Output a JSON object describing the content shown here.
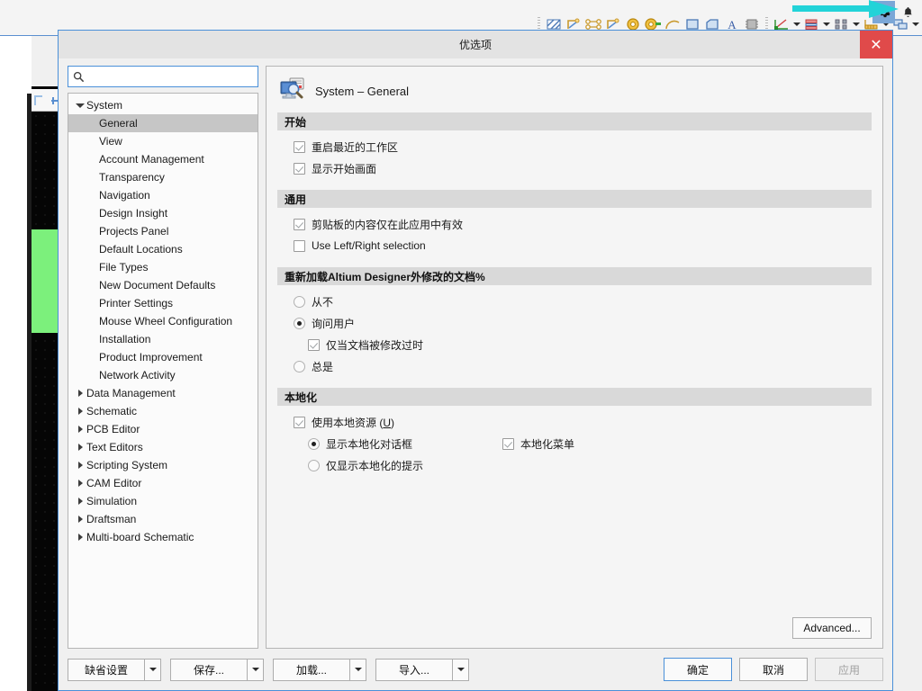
{
  "background": {
    "toolbar": {
      "icons": [
        "hatch-fill-icon",
        "polygon-pour-icon",
        "net-connect-icon",
        "polygon-cutout-icon",
        "via-icon",
        "pad-icon",
        "arc-icon",
        "fill-rect-icon",
        "board-shape-icon",
        "text-string-icon",
        "component-icon"
      ],
      "dropdown_groups": [
        "measure-tool-icon",
        "plane-layers-icon",
        "find-similar-icon",
        "dimension-icon",
        "layer-stack-icon"
      ],
      "gear_label": "gear-icon",
      "bell_label": "bell-icon"
    },
    "annotation_arrow_color": "#22d3d8"
  },
  "dialog": {
    "title": "优选项",
    "close_label": "✕",
    "search": {
      "value": "",
      "placeholder": ""
    },
    "tree": [
      {
        "label": "System",
        "level": 0,
        "twisty": "open",
        "selected": false
      },
      {
        "label": "General",
        "level": 1,
        "twisty": "none",
        "selected": true
      },
      {
        "label": "View",
        "level": 1,
        "twisty": "none",
        "selected": false
      },
      {
        "label": "Account Management",
        "level": 1,
        "twisty": "none",
        "selected": false
      },
      {
        "label": "Transparency",
        "level": 1,
        "twisty": "none",
        "selected": false
      },
      {
        "label": "Navigation",
        "level": 1,
        "twisty": "none",
        "selected": false
      },
      {
        "label": "Design Insight",
        "level": 1,
        "twisty": "none",
        "selected": false
      },
      {
        "label": "Projects Panel",
        "level": 1,
        "twisty": "none",
        "selected": false
      },
      {
        "label": "Default Locations",
        "level": 1,
        "twisty": "none",
        "selected": false
      },
      {
        "label": "File Types",
        "level": 1,
        "twisty": "none",
        "selected": false
      },
      {
        "label": "New Document Defaults",
        "level": 1,
        "twisty": "none",
        "selected": false
      },
      {
        "label": "Printer Settings",
        "level": 1,
        "twisty": "none",
        "selected": false
      },
      {
        "label": "Mouse Wheel Configuration",
        "level": 1,
        "twisty": "none",
        "selected": false
      },
      {
        "label": "Installation",
        "level": 1,
        "twisty": "none",
        "selected": false
      },
      {
        "label": "Product Improvement",
        "level": 1,
        "twisty": "none",
        "selected": false
      },
      {
        "label": "Network Activity",
        "level": 1,
        "twisty": "none",
        "selected": false
      },
      {
        "label": "Data Management",
        "level": 0,
        "twisty": "closed",
        "selected": false
      },
      {
        "label": "Schematic",
        "level": 0,
        "twisty": "closed",
        "selected": false
      },
      {
        "label": "PCB Editor",
        "level": 0,
        "twisty": "closed",
        "selected": false
      },
      {
        "label": "Text Editors",
        "level": 0,
        "twisty": "closed",
        "selected": false
      },
      {
        "label": "Scripting System",
        "level": 0,
        "twisty": "closed",
        "selected": false
      },
      {
        "label": "CAM Editor",
        "level": 0,
        "twisty": "closed",
        "selected": false
      },
      {
        "label": "Simulation",
        "level": 0,
        "twisty": "closed",
        "selected": false
      },
      {
        "label": "Draftsman",
        "level": 0,
        "twisty": "closed",
        "selected": false
      },
      {
        "label": "Multi-board Schematic",
        "level": 0,
        "twisty": "closed",
        "selected": false
      }
    ],
    "page": {
      "icon": "system-general-icon",
      "title": "System – General",
      "sections": [
        {
          "heading": "开始",
          "options": [
            {
              "type": "checkbox",
              "label": "重启最近的工作区",
              "checked": true,
              "indent": 1
            },
            {
              "type": "checkbox",
              "label": "显示开始画面",
              "checked": true,
              "indent": 1
            }
          ]
        },
        {
          "heading": "通用",
          "options": [
            {
              "type": "checkbox",
              "label": "剪贴板的内容仅在此应用中有效",
              "checked": true,
              "indent": 1
            },
            {
              "type": "checkbox",
              "label": "Use Left/Right selection",
              "checked": false,
              "indent": 1
            }
          ]
        },
        {
          "heading": "重新加载Altium Designer外修改的文档%",
          "options": [
            {
              "type": "radio",
              "label": "从不",
              "checked": false,
              "indent": 1
            },
            {
              "type": "radio",
              "label": "询问用户",
              "checked": true,
              "indent": 1
            },
            {
              "type": "checkbox",
              "label": "仅当文档被修改过时",
              "checked": true,
              "indent": 2
            },
            {
              "type": "radio",
              "label": "总是",
              "checked": false,
              "indent": 1
            }
          ]
        },
        {
          "heading": "本地化",
          "options": [
            {
              "type": "checkbox",
              "label": "使用本地资源 (U)",
              "checked": true,
              "indent": 1,
              "accel": "U"
            },
            {
              "type": "radio",
              "label": "显示本地化对话框",
              "checked": true,
              "indent": 2,
              "side": {
                "type": "checkbox",
                "label": "本地化菜单",
                "checked": true
              }
            },
            {
              "type": "radio",
              "label": "仅显示本地化的提示",
              "checked": false,
              "indent": 2
            }
          ]
        }
      ],
      "advanced_label": "Advanced..."
    },
    "footer": {
      "split_buttons": [
        {
          "label": "缺省设置"
        },
        {
          "label": "保存..."
        },
        {
          "label": "加载..."
        },
        {
          "label": "导入..."
        }
      ],
      "ok_label": "确定",
      "cancel_label": "取消",
      "apply_label": "应用",
      "apply_disabled": true
    }
  }
}
